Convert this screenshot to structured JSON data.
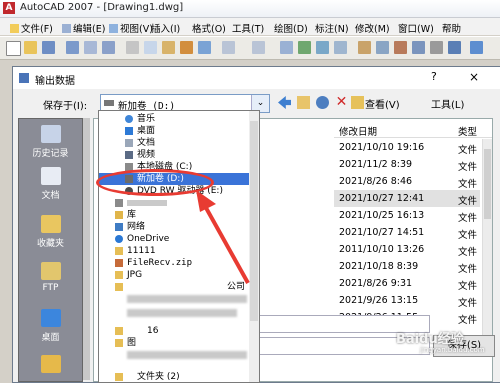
{
  "window": {
    "title": "AutoCAD 2007 - [Drawing1.dwg]"
  },
  "menubar": {
    "items": [
      "文件(F)",
      "编辑(E)",
      "视图(V)",
      "插入(I)",
      "格式(O)",
      "工具(T)",
      "绘图(D)",
      "标注(N)",
      "修改(M)",
      "窗口(W)",
      "帮助"
    ]
  },
  "dialog": {
    "title": "输出数据",
    "help": "?",
    "close": "×",
    "save_in_label": "保存于(I):",
    "save_in_value": "新加卷 (D:)",
    "view_menu": "查看(V)",
    "tools_menu": "工具(L)",
    "save_button": "保存(S)",
    "sidebar": [
      "历史记录",
      "文档",
      "收藏夹",
      "FTP",
      "桌面"
    ],
    "columns": {
      "modified": "修改日期",
      "type": "类型"
    },
    "rows": [
      {
        "date": "2021/10/10 19:16",
        "type": "文件"
      },
      {
        "date": "2021/11/2 8:39",
        "type": "文件"
      },
      {
        "date": "2021/8/26 8:46",
        "type": "文件"
      },
      {
        "date": "2021/10/27 12:41",
        "type": "文件"
      },
      {
        "date": "2021/10/25 16:13",
        "type": "文件"
      },
      {
        "date": "2021/10/27 14:51",
        "type": "文件"
      },
      {
        "date": "2011/10/10 13:26",
        "type": "文件"
      },
      {
        "date": "2021/10/18 8:39",
        "type": "文件"
      },
      {
        "date": "2021/8/26 9:31",
        "type": "文件"
      },
      {
        "date": "2021/9/26 13:15",
        "type": "文件"
      },
      {
        "date": "2021/9/26 11:55",
        "type": "文件"
      }
    ]
  },
  "dropdown": {
    "items": [
      "音乐",
      "桌面",
      "文档",
      "视频",
      "本地磁盘 (C:)",
      "新加卷 (D:)",
      "DVD RW 驱动器 (E:)",
      "",
      "库",
      "网络",
      "OneDrive",
      "11111",
      "FileRecv.zip",
      "JPG",
      "公司",
      "16",
      "图",
      "文件夹 (2)"
    ],
    "selected_index": 5
  },
  "watermark": {
    "text": "Baidu经验",
    "url": "jingyan.baidu.com"
  },
  "colors": {
    "accent": "#3a73d8",
    "annotation": "#e83b32"
  }
}
